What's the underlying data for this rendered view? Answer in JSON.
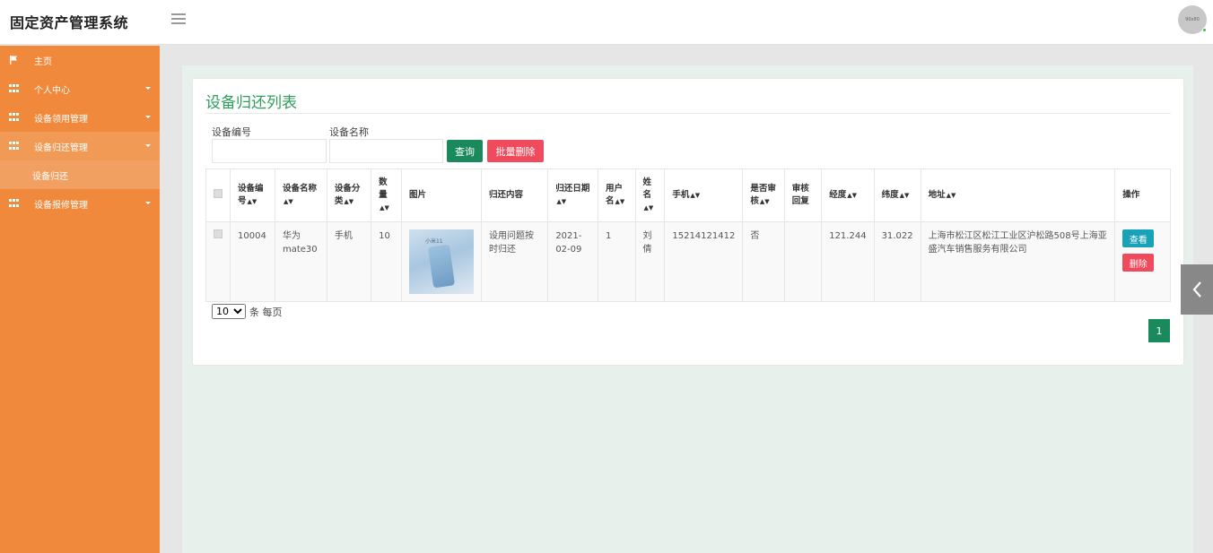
{
  "app": {
    "title": "固定资产管理系统",
    "avatar_text": "90x80"
  },
  "sidebar": {
    "items": [
      {
        "label": "主页",
        "icon": "flag-icon"
      },
      {
        "label": "个人中心",
        "icon": "grid-icon"
      },
      {
        "label": "设备领用管理",
        "icon": "grid-icon"
      },
      {
        "label": "设备归还管理",
        "icon": "grid-icon"
      },
      {
        "label": "设备报修管理",
        "icon": "grid-icon"
      }
    ],
    "subitem": "设备归还"
  },
  "page": {
    "title": "设备归还列表",
    "search": {
      "code_label": "设备编号",
      "code_value": "",
      "name_label": "设备名称",
      "name_value": "",
      "query_btn": "查询",
      "batch_delete_btn": "批量删除"
    }
  },
  "table": {
    "headers": [
      "设备编号",
      "设备名称",
      "设备分类",
      "数量",
      "图片",
      "归还内容",
      "归还日期",
      "用户名",
      "姓名",
      "手机",
      "是否审核",
      "审核回复",
      "经度",
      "纬度",
      "地址",
      "操作"
    ],
    "rows": [
      {
        "code": "10004",
        "name": "华为mate30",
        "category": "手机",
        "quantity": "10",
        "image_text": "小米11",
        "content": "设用问题按时归还",
        "date": "2021-02-09",
        "username": "1",
        "realname": "刘倩",
        "phone": "15214121412",
        "reviewed": "否",
        "reply": "",
        "lng": "121.244",
        "lat": "31.022",
        "address": "上海市松江区松江工业区沪松路508号上海亚盛汽车销售服务有限公司",
        "view_btn": "查看",
        "delete_btn": "删除"
      }
    ]
  },
  "pagination": {
    "page_size": "10",
    "page_size_suffix": "条 每页",
    "current_page": "1"
  },
  "colors": {
    "sidebar": "#f0893b",
    "accent": "#1a8a5d",
    "danger": "#f04a5d",
    "info": "#17a2b8",
    "title": "#2e9e5b"
  }
}
